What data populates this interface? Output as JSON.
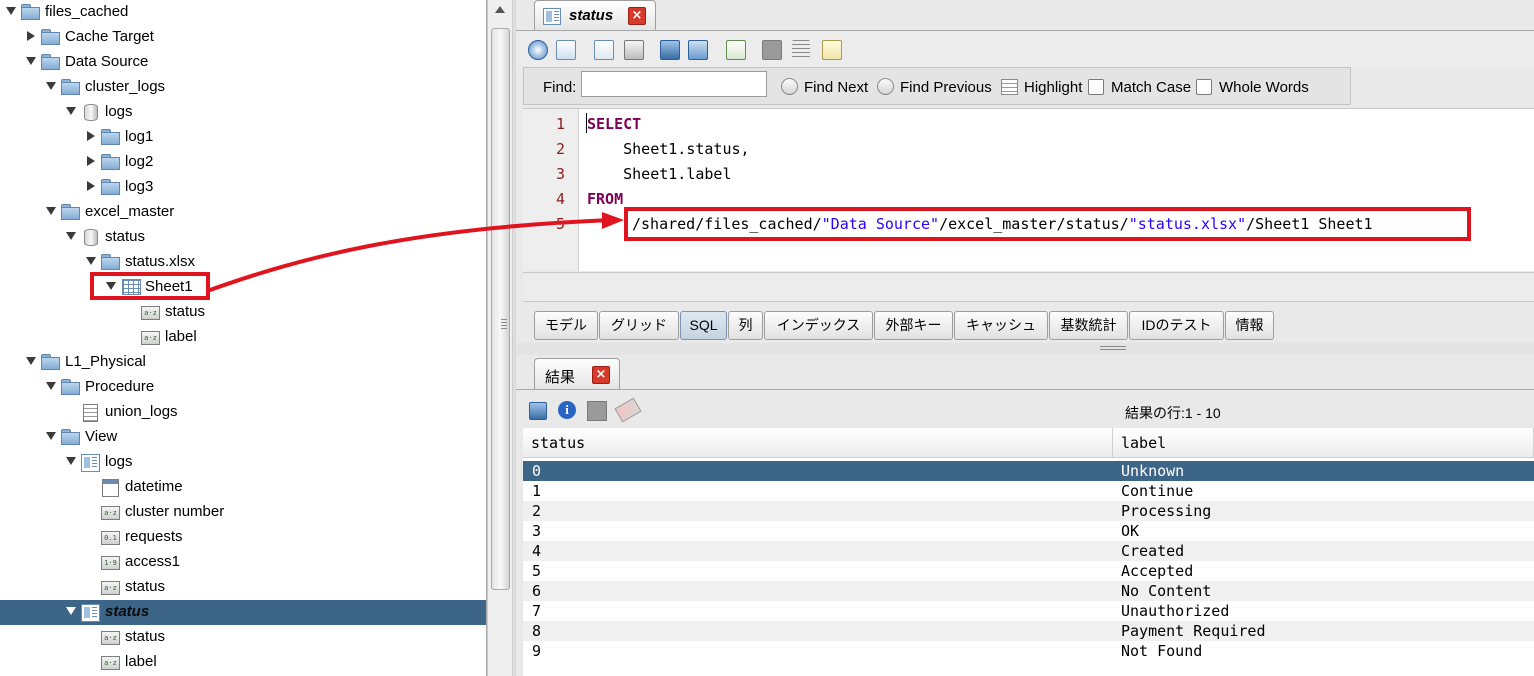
{
  "tree": {
    "items": [
      {
        "label": "files_cached",
        "icon": "folder-icon"
      },
      {
        "label": "Cache Target",
        "icon": "folder-icon"
      },
      {
        "label": "Data Source",
        "icon": "folder-icon"
      },
      {
        "label": "cluster_logs",
        "icon": "folder-icon"
      },
      {
        "label": "logs",
        "icon": "database-icon"
      },
      {
        "label": "log1",
        "icon": "folder-icon"
      },
      {
        "label": "log2",
        "icon": "folder-icon"
      },
      {
        "label": "log3",
        "icon": "folder-icon"
      },
      {
        "label": "excel_master",
        "icon": "folder-icon"
      },
      {
        "label": "status",
        "icon": "database-icon"
      },
      {
        "label": "status.xlsx",
        "icon": "folder-icon"
      },
      {
        "label": "Sheet1",
        "icon": "sheet-icon"
      },
      {
        "label": "status",
        "icon": "column-icon"
      },
      {
        "label": "label",
        "icon": "column-icon"
      },
      {
        "label": "L1_Physical",
        "icon": "folder-icon"
      },
      {
        "label": "Procedure",
        "icon": "folder-icon"
      },
      {
        "label": "union_logs",
        "icon": "procedure-icon"
      },
      {
        "label": "View",
        "icon": "folder-icon"
      },
      {
        "label": "logs",
        "icon": "view-icon"
      },
      {
        "label": "datetime",
        "icon": "date-column-icon"
      },
      {
        "label": "cluster number",
        "icon": "column-icon"
      },
      {
        "label": "requests",
        "icon": "column-icon"
      },
      {
        "label": "access1",
        "icon": "column-icon"
      },
      {
        "label": "status",
        "icon": "column-icon"
      },
      {
        "label": "status",
        "icon": "view-icon"
      },
      {
        "label": "status",
        "icon": "column-icon"
      },
      {
        "label": "label",
        "icon": "column-icon"
      }
    ]
  },
  "editor_tab": {
    "label": "status"
  },
  "find_bar": {
    "find_label": "Find:",
    "find_value": "",
    "find_next": "Find Next",
    "find_previous": "Find Previous",
    "highlight": "Highlight",
    "match_case": "Match Case",
    "whole_words": "Whole Words"
  },
  "sql": {
    "line_numbers": [
      "1",
      "2",
      "3",
      "4",
      "5"
    ],
    "select_kw": "SELECT",
    "line2": "    Sheet1.status,",
    "line3": "    Sheet1.label",
    "from_kw": "FROM",
    "line5_a": "/shared/files_cached/",
    "line5_b": "\"Data Source\"",
    "line5_c": "/excel_master/status/",
    "line5_d": "\"status.xlsx\"",
    "line5_e": "/Sheet1",
    "line5_f": " Sheet1"
  },
  "bottom_tabs": [
    "モデル",
    "グリッド",
    "SQL",
    "列",
    "インデックス",
    "外部キー",
    "キャッシュ",
    "基数統計",
    "IDのテスト",
    "情報"
  ],
  "bottom_tabs_active": "SQL",
  "results": {
    "tab_label": "結果",
    "row_info": "結果の行:1 - 10",
    "columns": [
      "status",
      "label"
    ],
    "rows": [
      [
        "0",
        "Unknown"
      ],
      [
        "1",
        "Continue"
      ],
      [
        "2",
        "Processing"
      ],
      [
        "3",
        "OK"
      ],
      [
        "4",
        "Created"
      ],
      [
        "5",
        "Accepted"
      ],
      [
        "6",
        "No Content"
      ],
      [
        "7",
        "Unauthorized"
      ],
      [
        "8",
        "Payment Required"
      ],
      [
        "9",
        "Not Found"
      ]
    ]
  },
  "colors": {
    "selection": "#3d6587",
    "annotation": "#e0141e",
    "sql_keyword": "#7f0055",
    "sql_string": "#2a00ff"
  }
}
